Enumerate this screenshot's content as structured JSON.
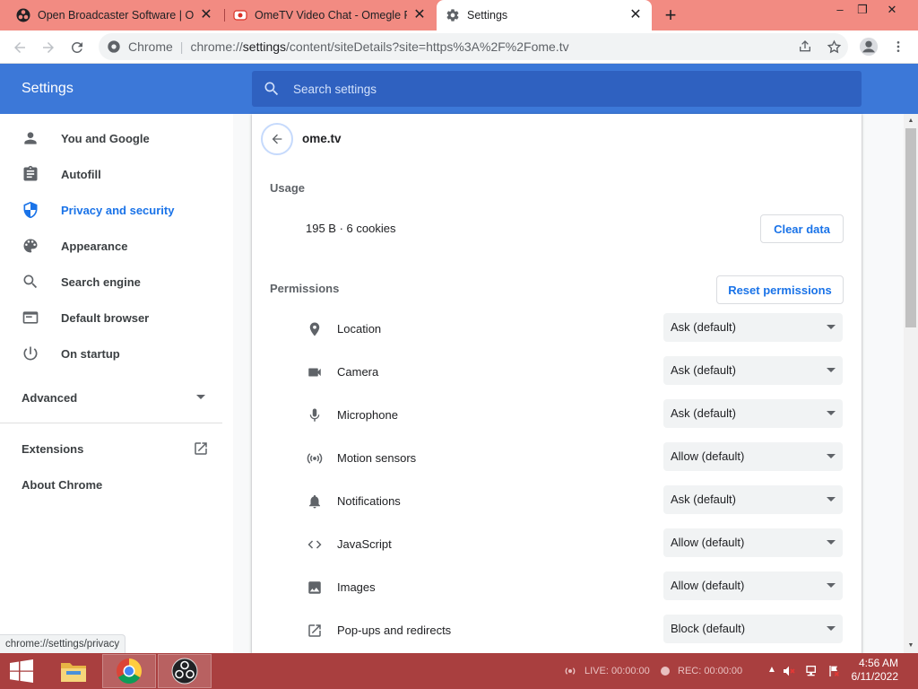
{
  "browser": {
    "tabs": [
      {
        "title": "Open Broadcaster Software | OBS",
        "close": "✕"
      },
      {
        "title": "OmeTV Video Chat - Omegle Ra",
        "close": "✕"
      },
      {
        "title": "Settings",
        "close": "✕"
      }
    ],
    "new_tab": "+",
    "window_controls": {
      "minimize": "–",
      "restore": "❐",
      "close": "✕"
    },
    "omnibox": {
      "chip": "Chrome",
      "separator": "|",
      "url_prefix": "chrome://",
      "url_main": "settings",
      "url_rest": "/content/siteDetails?site=https%3A%2F%2Fome.tv"
    }
  },
  "header": {
    "title": "Settings",
    "search_placeholder": "Search settings"
  },
  "sidebar": {
    "items": [
      {
        "label": "You and Google",
        "icon": "person-icon"
      },
      {
        "label": "Autofill",
        "icon": "clipboard-icon"
      },
      {
        "label": "Privacy and security",
        "icon": "shield-icon"
      },
      {
        "label": "Appearance",
        "icon": "palette-icon"
      },
      {
        "label": "Search engine",
        "icon": "search-icon"
      },
      {
        "label": "Default browser",
        "icon": "browser-icon"
      },
      {
        "label": "On startup",
        "icon": "power-icon"
      }
    ],
    "advanced": "Advanced",
    "extensions": "Extensions",
    "about": "About Chrome",
    "selected": "Privacy and security"
  },
  "content": {
    "site": "ome.tv",
    "usage_label": "Usage",
    "usage_value": "195 B · 6 cookies",
    "clear_button": "Clear data",
    "permissions_label": "Permissions",
    "reset_button": "Reset permissions",
    "permissions": [
      {
        "label": "Location",
        "value": "Ask (default)",
        "icon": "location-icon"
      },
      {
        "label": "Camera",
        "value": "Ask (default)",
        "icon": "camera-icon"
      },
      {
        "label": "Microphone",
        "value": "Ask (default)",
        "icon": "microphone-icon"
      },
      {
        "label": "Motion sensors",
        "value": "Allow (default)",
        "icon": "motion-sensors-icon"
      },
      {
        "label": "Notifications",
        "value": "Ask (default)",
        "icon": "bell-icon"
      },
      {
        "label": "JavaScript",
        "value": "Allow (default)",
        "icon": "code-icon"
      },
      {
        "label": "Images",
        "value": "Allow (default)",
        "icon": "image-icon"
      },
      {
        "label": "Pop-ups and redirects",
        "value": "Block (default)",
        "icon": "open-external-icon"
      }
    ]
  },
  "status_bar": {
    "url": "chrome://settings/privacy"
  },
  "taskbar": {
    "live": "LIVE: 00:00:00",
    "rec": "REC: 00:00:00",
    "time": "4:56 AM",
    "date": "6/11/2022"
  },
  "colors": {
    "tab_strip": "#f28b82",
    "header": "#3c78d8",
    "accent": "#1a73e8",
    "taskbar": "#a93f3f"
  }
}
